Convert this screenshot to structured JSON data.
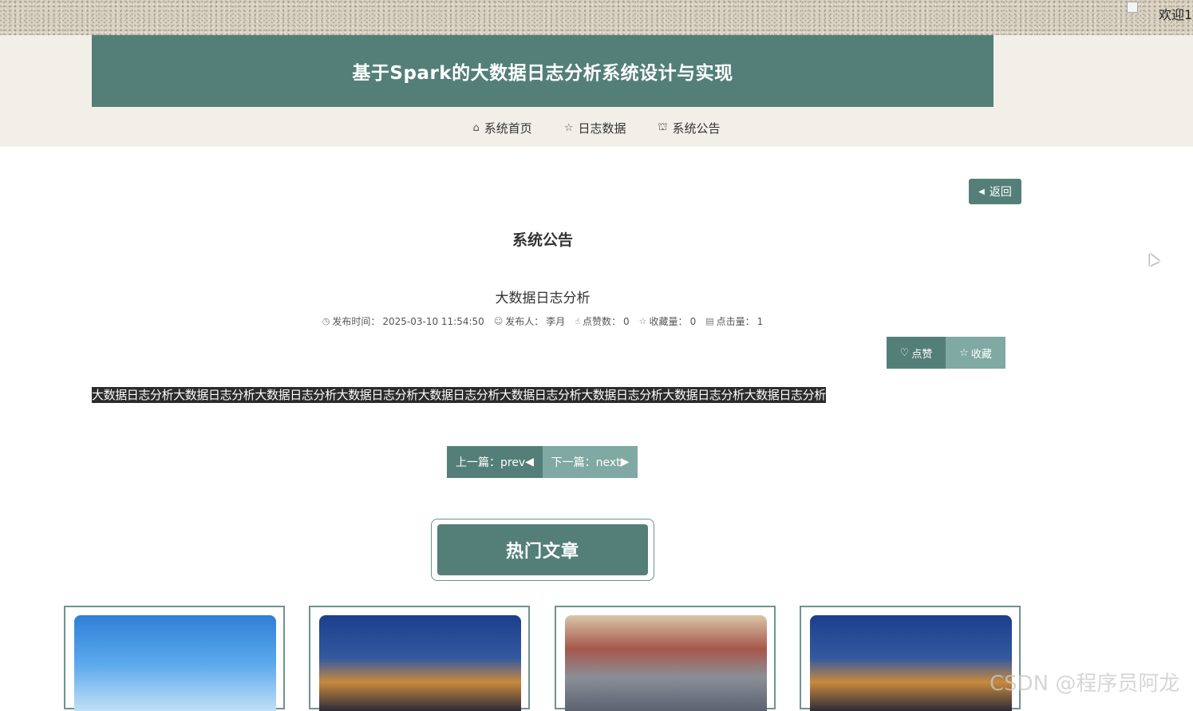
{
  "header": {
    "welcome": "欢迎1",
    "site_title": "基于Spark的大数据日志分析系统设计与实现"
  },
  "nav": {
    "items": [
      {
        "label": "系统首页",
        "icon": "home-icon"
      },
      {
        "label": "日志数据",
        "icon": "star-icon"
      },
      {
        "label": "系统公告",
        "icon": "bag-icon"
      }
    ]
  },
  "page": {
    "back_label": "返回",
    "section_title": "系统公告",
    "article_title": "大数据日志分析",
    "meta": {
      "time_label": "发布时间：",
      "time_value": "2025-03-10 11:54:50",
      "author_label": "发布人：",
      "author_value": "李月",
      "likes_label": "点赞数：",
      "likes_value": "0",
      "favs_label": "收藏量：",
      "favs_value": "0",
      "clicks_label": "点击量：",
      "clicks_value": "1"
    },
    "like_label": "点赞",
    "fav_label": "收藏",
    "content": "大数据日志分析大数据日志分析大数据日志分析大数据日志分析大数据日志分析大数据日志分析大数据日志分析大数据日志分析大数据日志分析",
    "prev_label": "上一篇：prev",
    "next_label": "下一篇：next",
    "hot_title": "热门文章"
  },
  "watermark": "CSDN @程序员阿龙",
  "colors": {
    "primary": "#547f79",
    "secondary": "#7fa9a2",
    "header_bg": "#f1efe8"
  }
}
